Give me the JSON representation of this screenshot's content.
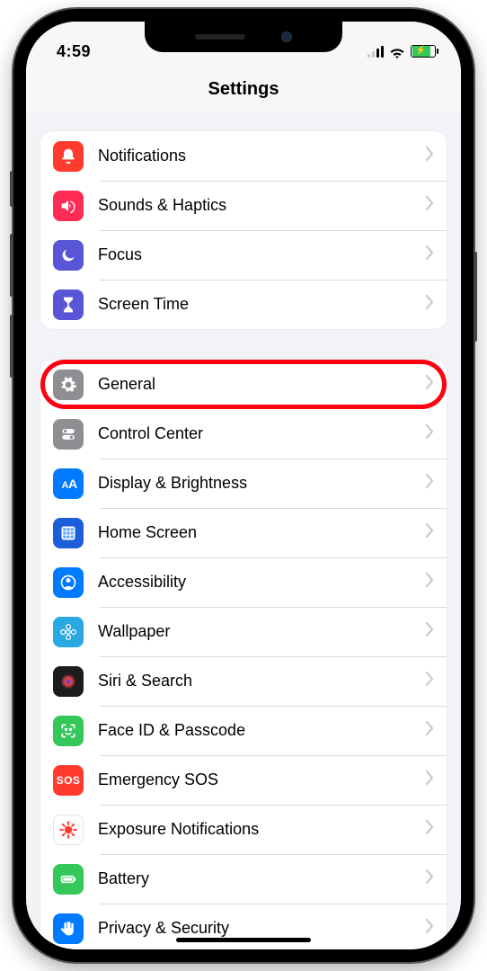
{
  "status": {
    "time": "4:59"
  },
  "navbar": {
    "title": "Settings"
  },
  "group1": [
    {
      "icon": "bell-icon",
      "bg": "ic-red",
      "label": "Notifications"
    },
    {
      "icon": "speaker-icon",
      "bg": "ic-pink",
      "label": "Sounds & Haptics"
    },
    {
      "icon": "moon-icon",
      "bg": "ic-indigo",
      "label": "Focus"
    },
    {
      "icon": "hourglass-icon",
      "bg": "ic-indigo",
      "label": "Screen Time"
    }
  ],
  "group2": [
    {
      "icon": "gear-icon",
      "bg": "ic-grey",
      "label": "General",
      "highlight": true
    },
    {
      "icon": "toggles-icon",
      "bg": "ic-grey",
      "label": "Control Center"
    },
    {
      "icon": "textsize-icon",
      "bg": "ic-blue",
      "label": "Display & Brightness"
    },
    {
      "icon": "grid-icon",
      "bg": "ic-darkblue",
      "label": "Home Screen"
    },
    {
      "icon": "person-icon",
      "bg": "ic-blue",
      "label": "Accessibility"
    },
    {
      "icon": "flower-icon",
      "bg": "ic-cyan",
      "label": "Wallpaper"
    },
    {
      "icon": "siri-icon",
      "bg": "ic-black",
      "label": "Siri & Search"
    },
    {
      "icon": "faceid-icon",
      "bg": "ic-green",
      "label": "Face ID & Passcode"
    },
    {
      "icon": "sos-icon",
      "bg": "ic-red",
      "label": "Emergency SOS"
    },
    {
      "icon": "virus-icon",
      "bg": "ic-white",
      "label": "Exposure Notifications"
    },
    {
      "icon": "battery-icon",
      "bg": "ic-green",
      "label": "Battery"
    },
    {
      "icon": "hand-icon",
      "bg": "ic-blue",
      "label": "Privacy & Security"
    }
  ]
}
